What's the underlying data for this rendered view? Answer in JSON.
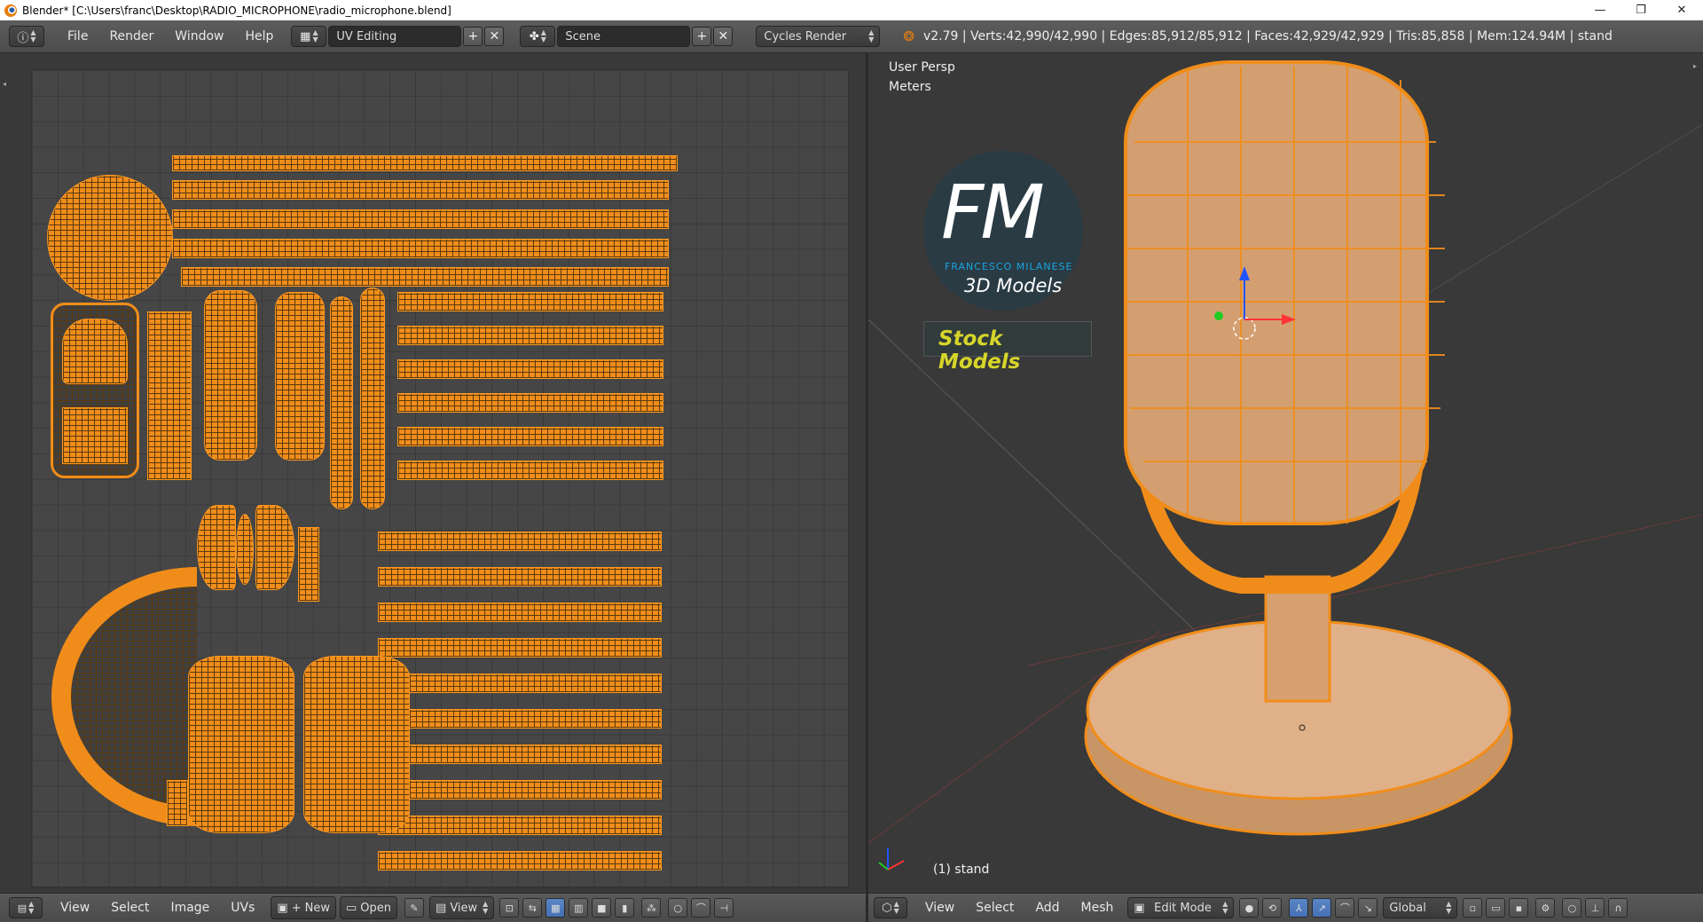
{
  "window": {
    "title": "Blender* [C:\\Users\\franc\\Desktop\\RADIO_MICROPHONE\\radio_microphone.blend]",
    "controls": [
      "—",
      "❐",
      "✕"
    ]
  },
  "top_menu": {
    "items": [
      "File",
      "Render",
      "Window",
      "Help"
    ],
    "screen_layout": "UV Editing",
    "scene": "Scene",
    "render_engine": "Cycles Render",
    "stats": "v2.79 | Verts:42,990/42,990 | Edges:85,912/85,912 | Faces:42,929/42,929 | Tris:85,858 | Mem:124.94M | stand"
  },
  "uv_editor_header": {
    "menus": [
      "View",
      "Select",
      "Image",
      "UVs"
    ],
    "new_label": "New",
    "open_label": "Open",
    "view_label": "View"
  },
  "viewport": {
    "view_name": "User Persp",
    "units": "Meters",
    "object_label": "(1) stand",
    "logo": {
      "letters": "FM",
      "author": "FRANCESCO MILANESE",
      "product": "3D Models",
      "banner": "Stock Models"
    }
  },
  "viewport_header": {
    "menus": [
      "View",
      "Select",
      "Add",
      "Mesh"
    ],
    "mode": "Edit Mode",
    "orientation": "Global"
  },
  "colors": {
    "accent_orange": "#f08d1a",
    "logo_blue": "#1aa3e0",
    "banner_yellow": "#d6d62a"
  }
}
